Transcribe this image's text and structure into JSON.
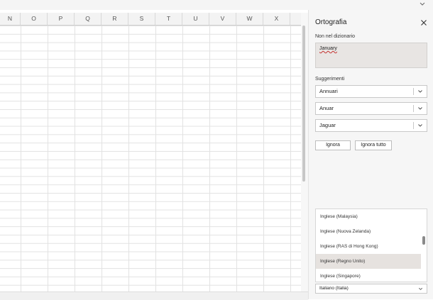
{
  "sheet": {
    "columns": [
      "N",
      "O",
      "P",
      "Q",
      "R",
      "S",
      "T",
      "U",
      "V",
      "W",
      "X"
    ]
  },
  "pane": {
    "title": "Ortografia",
    "not_in_dictionary_label": "Non nel dizionario",
    "misspelled_word": "January",
    "suggestions_label": "Suggerimenti",
    "suggestions": [
      "Annuari",
      "Anuar",
      "Jaguar"
    ],
    "ignore_label": "Ignora",
    "ignore_all_label": "Ignora tutto",
    "language_options": [
      "Inglese (Malaysia)",
      "Inglese (Nuova Zelanda)",
      "Inglese (RAS di Hong Kong)",
      "Inglese (Regno Unito)",
      "Inglese (Singapore)"
    ],
    "highlighted_language": "Inglese (Regno Unito)",
    "selected_language": "Italiano (Italia)"
  },
  "icons": {
    "close": "close-icon",
    "dropdown": "chevron-down-icon"
  },
  "colors": {
    "pane_background": "#f6f6f6",
    "misspelling_underline": "#c4312f",
    "highlight": "#e6e2df"
  }
}
